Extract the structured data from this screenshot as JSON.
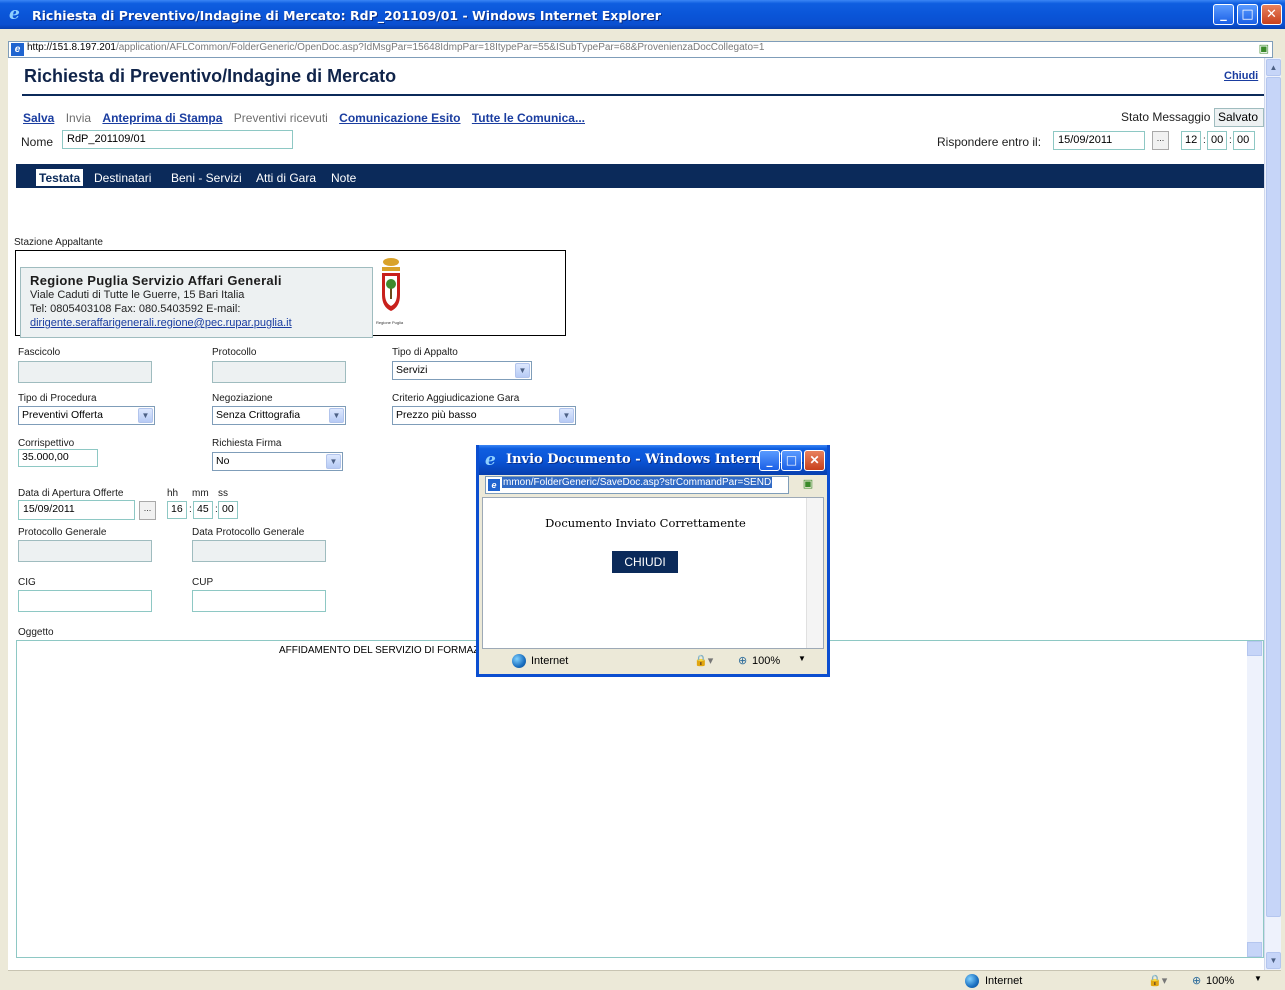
{
  "window": {
    "title": "Richiesta di Preventivo/Indagine di Mercato: RdP_201109/01 - Windows Internet Explorer",
    "url_host": "http://151.8.197.201",
    "url_path": "/application/AFLCommon/FolderGeneric/OpenDoc.asp?IdMsgPar=15648IdmpPar=18ItypePar=55&ISubTypePar=68&ProvenienzaDocCollegato=1"
  },
  "page": {
    "title": "Richiesta di Preventivo/Indagine di Mercato",
    "close_label": "Chiudi"
  },
  "toolbar": {
    "salva": "Salva",
    "invia": "Invia",
    "anteprima": "Anteprima di Stampa",
    "preventivi": "Preventivi ricevuti",
    "comunicazione": "Comunicazione Esito",
    "tutte": "Tutte le Comunica..."
  },
  "header": {
    "stato_label": "Stato Messaggio",
    "stato_value": "Salvato",
    "nome_label": "Nome",
    "nome_value": "RdP_201109/01",
    "rispondere_label": "Rispondere entro il:",
    "rispondere_date": "15/09/2011",
    "rispondere_hh": "12",
    "rispondere_mm": "00",
    "rispondere_ss": "00",
    "picker": "..."
  },
  "tabs": [
    "Testata",
    "Destinatari",
    "Beni - Servizi",
    "Atti di Gara",
    "Note"
  ],
  "station": {
    "label": "Stazione Appaltante",
    "name": "Regione Puglia Servizio Affari Generali",
    "address": "Viale Caduti di Tutte le Guerre, 15 Bari Italia",
    "contacts": "Tel: 0805403108 Fax: 080.5403592 E-mail:",
    "email": "dirigente.seraffarigenerali.regione@pec.rupar.puglia.it",
    "logo_caption": "Regione Puglia"
  },
  "form": {
    "fascicolo_label": "Fascicolo",
    "protocollo_label": "Protocollo",
    "tipo_appalto_label": "Tipo di Appalto",
    "tipo_appalto_value": "Servizi",
    "tipo_procedura_label": "Tipo di Procedura",
    "tipo_procedura_value": "Preventivi Offerta",
    "negoziazione_label": "Negoziazione",
    "negoziazione_value": "Senza Crittografia",
    "criterio_label": "Criterio Aggiudicazione Gara",
    "criterio_value": "Prezzo più basso",
    "corrispettivo_label": "Corrispettivo",
    "corrispettivo_value": "35.000,00",
    "richiesta_firma_label": "Richiesta Firma",
    "richiesta_firma_value": "No",
    "data_apertura_label": "Data di Apertura Offerte",
    "hh_label": "hh",
    "mm_label": "mm",
    "ss_label": "ss",
    "data_apertura_value": "15/09/2011",
    "apertura_hh": "16",
    "apertura_mm": "45",
    "apertura_ss": "00",
    "protocollo_generale_label": "Protocollo Generale",
    "data_protocollo_label": "Data Protocollo Generale",
    "cig_label": "CIG",
    "cup_label": "CUP",
    "oggetto_label": "Oggetto",
    "oggetto_value": "AFFIDAMENTO DEL SERVIZIO DI FORMAZ"
  },
  "popup": {
    "title": "Invio Documento - Windows Internet E...",
    "url": "mmon/FolderGeneric/SaveDoc.asp?strCommandPar=SEND",
    "message": "Documento Inviato Correttamente",
    "button": "CHIUDI",
    "zone": "Internet",
    "zoom": "100%"
  },
  "status": {
    "zone": "Internet",
    "zoom": "100%"
  }
}
